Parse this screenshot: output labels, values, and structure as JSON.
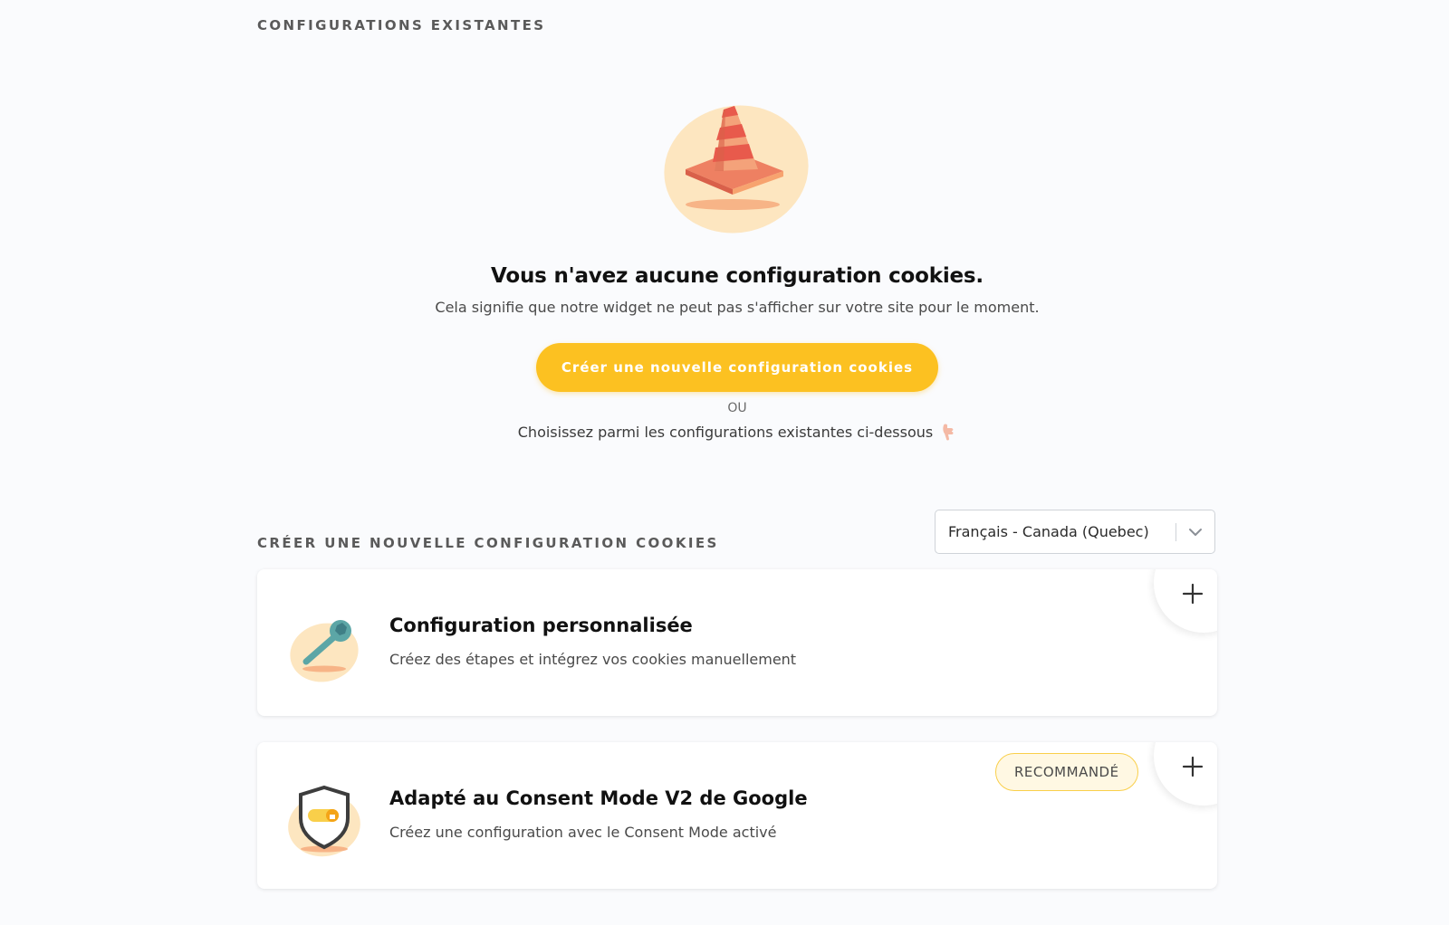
{
  "existing": {
    "section_title": "CONFIGURATIONS EXISTANTES",
    "empty_title": "Vous n'avez aucune configuration cookies.",
    "empty_subtitle": "Cela signifie que notre widget ne peut pas s'afficher sur votre site pour le moment.",
    "create_button": "Créer une nouvelle configuration cookies",
    "or_label": "OU",
    "choose_text": "Choisissez parmi les configurations existantes ci-dessous",
    "illustration": "traffic-cone-icon",
    "hand_icon": "pointing-down-hand-icon"
  },
  "create": {
    "section_title": "CRÉER UNE NOUVELLE CONFIGURATION COOKIES",
    "language_select": {
      "value": "Français - Canada (Quebec)"
    },
    "cards": [
      {
        "title": "Configuration personnalisée",
        "description": "Créez des étapes et intégrez vos cookies manuellement",
        "icon": "wrench-icon"
      },
      {
        "title": "Adapté au Consent Mode V2 de Google",
        "description": "Créez une configuration avec le Consent Mode activé",
        "badge": "RECOMMANDÉ",
        "icon": "shield-toggle-icon"
      }
    ]
  },
  "colors": {
    "accent": "#fcc121",
    "background": "#fafbfd",
    "badge_border": "#f9cf4a",
    "badge_bg": "#fff8e3"
  }
}
